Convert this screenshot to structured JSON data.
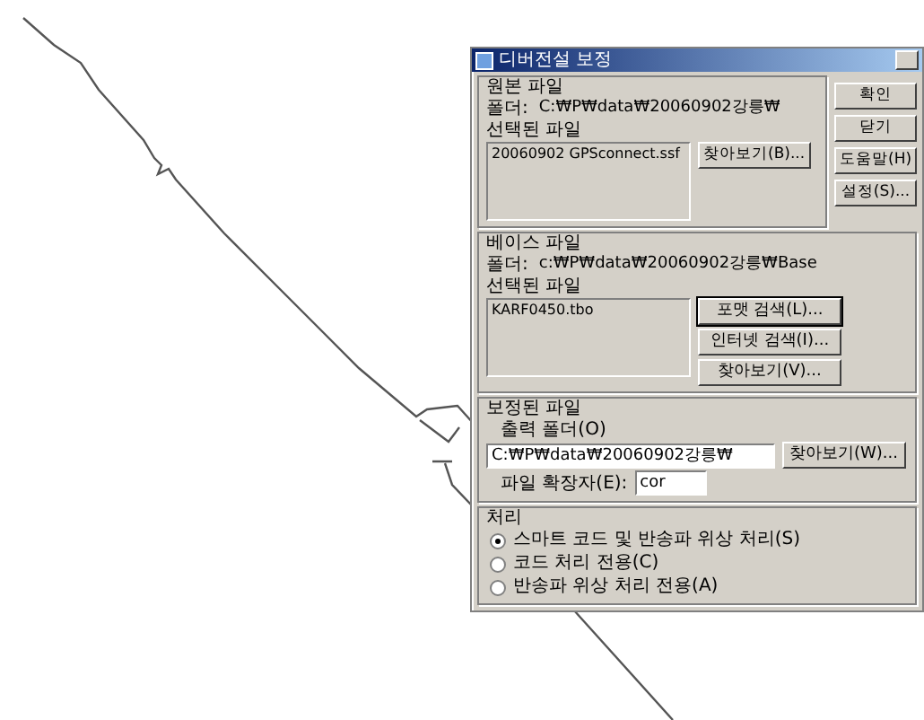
{
  "window": {
    "title": "디버전설 보정"
  },
  "source_file": {
    "legend": "원본 파일",
    "folder_label": "폴더:",
    "folder": "C:₩P₩data₩20060902강릉₩",
    "selected_label": "선택된 파일",
    "files": [
      "20060902 GPSconnect.ssf"
    ],
    "browse_button": "찾아보기(B)..."
  },
  "side_buttons": [
    "확인",
    "닫기",
    "도움말(H)",
    "설정(S)..."
  ],
  "base_file": {
    "legend": "베이스 파일",
    "folder_label": "폴더:",
    "folder": "c:₩P₩data₩20060902강릉₩Base",
    "selected_label": "선택된 파일",
    "files": [
      "KARF0450.tbo"
    ],
    "buttons": [
      {
        "label": "포맷 검색(L)...",
        "default": true
      },
      {
        "label": "인터넷 검색(I)...",
        "default": false
      },
      {
        "label": "찾아보기(V)...",
        "default": false
      }
    ]
  },
  "output_file": {
    "legend": "보정된 파일",
    "folder_label": "출력 폴더(O)",
    "folder": "C:₩P₩data₩20060902강릉₩",
    "browse_button": "찾아보기(W)...",
    "extension_label": "파일 확장자(E):",
    "extension": "cor"
  },
  "processing": {
    "legend": "처리",
    "options": [
      {
        "label": "스마트 코드 및 반송파 위상 처리(S)",
        "selected": true
      },
      {
        "label": "코드 처리 전용(C)",
        "selected": false
      },
      {
        "label": "반송파 위상 처리 전용(A)",
        "selected": false
      }
    ]
  }
}
